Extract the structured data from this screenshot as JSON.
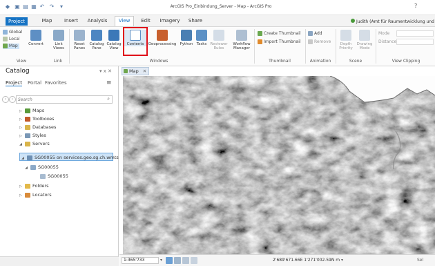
{
  "title_bar": {
    "title": "ArcGIS Pro_Einbindung_Server - Map - ArcGIS Pro",
    "help": "?"
  },
  "menu_tabs": [
    "Project",
    "Map",
    "Insert",
    "Analysis",
    "View",
    "Edit",
    "Imagery",
    "Share"
  ],
  "active_tab": "View",
  "user": "Judith (Amt für Raumentwicklung und",
  "ribbon": {
    "view_group": {
      "label": "View",
      "items": [
        "Global",
        "Local",
        "Map"
      ]
    },
    "link_group": {
      "label": "Link",
      "convert": "Convert",
      "link_views": "Link Views",
      "link_views_2": "▾"
    },
    "windows_group": {
      "label": "Windows",
      "reset_panes": "Reset Panes",
      "catalog_pane": "Catalog Pane",
      "catalog_view": "Catalog View",
      "contents": "Contents",
      "geoprocessing": "Geoprocessing",
      "python": "Python",
      "tasks": "Tasks",
      "reviewer_rules": "Reviewer Rules",
      "workflow_manager": "Workflow Manager"
    },
    "thumbnail_group": {
      "label": "Thumbnail",
      "create": "Create Thumbnail",
      "import": "Import Thumbnail"
    },
    "animation_group": {
      "label": "Animation",
      "add": "Add",
      "remove": "Remove"
    },
    "scene_group": {
      "label": "Scene",
      "depth_priority": "Depth Priority",
      "drawing_mode": "Drawing Mode"
    },
    "clipping_group": {
      "label": "View Clipping",
      "mode": "Mode",
      "distance": "Distance"
    }
  },
  "catalog": {
    "title": "Catalog",
    "pin": "▾ ⅹ ✕",
    "tabs": [
      "Project",
      "Portal",
      "Favorites"
    ],
    "menu": "≡",
    "search_placeholder": "Search",
    "tree": [
      {
        "label": "Maps"
      },
      {
        "label": "Toolboxes"
      },
      {
        "label": "Databases"
      },
      {
        "label": "Styles"
      },
      {
        "label": "Servers"
      },
      {
        "label": "SG00055 on services.geo.sg.ch.wmts"
      },
      {
        "label": "SG00055"
      },
      {
        "label": "SG00055"
      },
      {
        "label": "Folders"
      },
      {
        "label": "Locators"
      }
    ]
  },
  "map": {
    "tab": "Map",
    "scale": "1:365'733",
    "coords": "2'689'671.66E 1'271'002.59N m",
    "right_status": "Sel"
  },
  "colors": {
    "accent": "#1673c4",
    "highlight": "#e0101a",
    "selection": "#cde3f7"
  }
}
